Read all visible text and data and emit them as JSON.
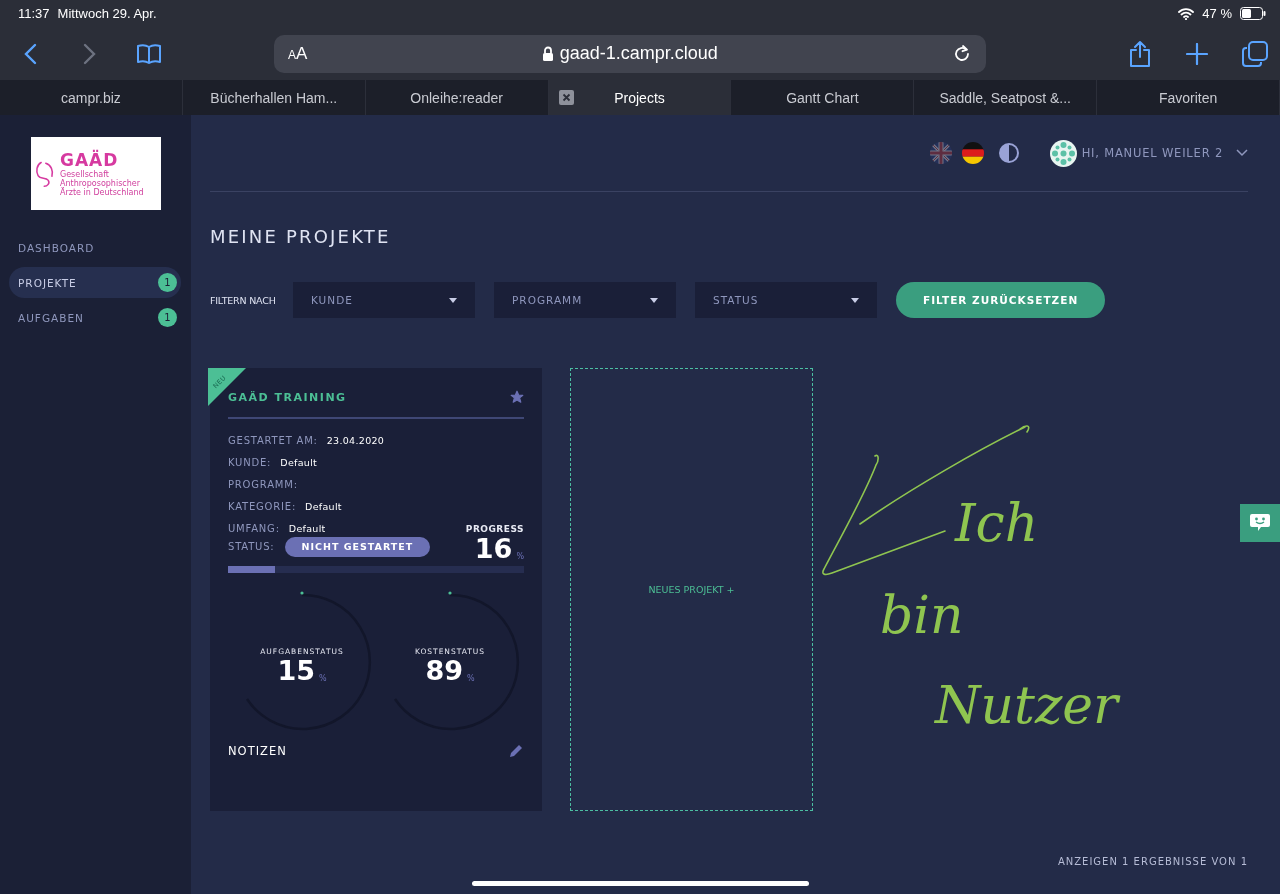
{
  "status_bar": {
    "time": "11:37",
    "date": "Mittwoch 29. Apr.",
    "battery": "47 %"
  },
  "browser": {
    "text_size": "AA",
    "url": "gaad-1.campr.cloud"
  },
  "tabs": [
    {
      "label": "campr.biz",
      "selected": false
    },
    {
      "label": "Bücherhallen Ham...",
      "selected": false
    },
    {
      "label": "Onleihe:reader",
      "selected": false
    },
    {
      "label": "Projects",
      "selected": true
    },
    {
      "label": "Gantt Chart",
      "selected": false
    },
    {
      "label": "Saddle, Seatpost &...",
      "selected": false
    },
    {
      "label": "Favoriten",
      "selected": false
    }
  ],
  "sidebar": {
    "logo": {
      "name": "GAÄD",
      "tagline": "Gesellschaft Anthroposophischer Ärzte in Deutschland"
    },
    "items": [
      {
        "label": "DASHBOARD",
        "selected": false
      },
      {
        "label": "PROJEKTE",
        "selected": true,
        "count": "1"
      },
      {
        "label": "AUFGABEN",
        "selected": false,
        "count": "1"
      }
    ]
  },
  "header": {
    "languages": [
      {
        "kind": "uk",
        "selected": false
      },
      {
        "kind": "de",
        "selected": true
      }
    ],
    "user": "HI, MANUEL WEILER 2"
  },
  "page": {
    "title": "MEINE PROJEKTE",
    "filter_label": "FILTERN NACH",
    "filters": [
      {
        "placeholder": "KUNDE"
      },
      {
        "placeholder": "PROGRAMM"
      },
      {
        "placeholder": "STATUS"
      }
    ],
    "reset_button": "FILTER ZURÜCKSETZEN"
  },
  "project": {
    "badge": "NEU",
    "title": "GAÄD TRAINING",
    "starred": true,
    "fields": [
      {
        "label": "GESTARTET AM:",
        "value": "23.04.2020"
      },
      {
        "label": "KUNDE:",
        "value": "Default"
      },
      {
        "label": "PROGRAMM:"
      },
      {
        "label": "KATEGORIE:",
        "value": "Default"
      },
      {
        "label": "UMFANG:",
        "value": "Default"
      }
    ],
    "status_label": "STATUS:",
    "status": "NICHT GESTARTET",
    "progress": {
      "label": "PROGRESS",
      "value": "16",
      "unit": "%",
      "level": 0.16
    },
    "gauges": [
      {
        "label": "AUFGABENSTATUS",
        "value": "15",
        "unit": "%"
      },
      {
        "label": "KOSTENSTATUS",
        "value": "89",
        "unit": "%"
      }
    ],
    "notes": "NOTIZEN"
  },
  "new_project": "NEUES PROJEKT +",
  "annotation": {
    "lines": [
      "Ich",
      "bin",
      "Nutzer"
    ]
  },
  "footer": "ANZEIGEN 1 ERGEBNISSE VON 1"
}
